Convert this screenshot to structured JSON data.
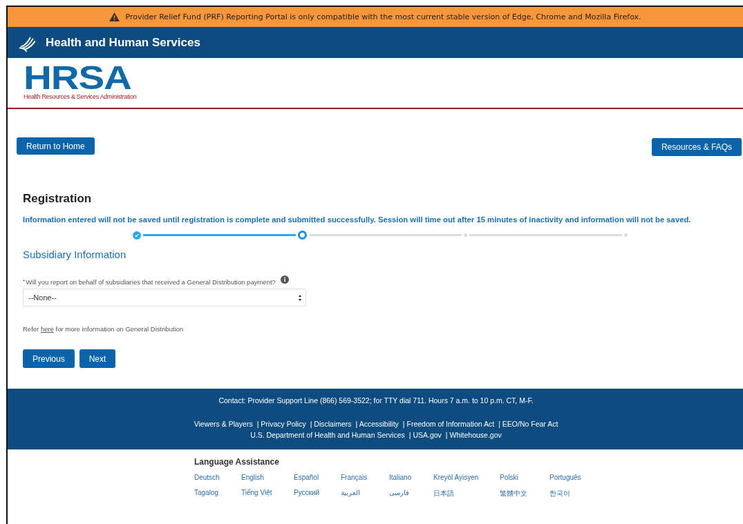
{
  "alert_bar": {
    "text": "Provider Relief Fund (PRF) Reporting Portal is only compatible with the most current stable version of Edge, Chrome and Mozilla Firefox."
  },
  "header": {
    "title": "Health and Human Services"
  },
  "logo": {
    "wordmark": "HRSA",
    "subtitle": "Health Resources & Services Administration"
  },
  "nav_buttons": [
    "Return to Home",
    "Resources & FAQs"
  ],
  "page_title": "Registration",
  "notice": "Information entered will not be saved until registration is complete and submitted successfully. Session will time out after 15 minutes of inactivity and information will not be saved.",
  "stepper": [
    {
      "kind": "complete"
    },
    {
      "kind": "current"
    },
    {
      "kind": "upcoming"
    },
    {
      "kind": "upcoming"
    }
  ],
  "section_title": "Subsidiary Information",
  "question": {
    "required_mark": "*",
    "label": "Will you report on behalf of subsidiaries that received a General Distribution payment?",
    "value": "--None--"
  },
  "refer": {
    "before": "Refer ",
    "link": "here",
    "after": " for more information on General Distribution"
  },
  "form_buttons": [
    "Previous",
    "Next"
  ],
  "footer": {
    "contact": "Contact: Provider Support Line (866) 569-3522; for TTY dial 711. Hours 7 a.m. to 10 p.m. CT, M-F.",
    "link_rows": [
      [
        "Viewers & Players",
        "| Privacy Policy",
        "| Disclaimers",
        "| Accessibility",
        "| Freedom of Information Act",
        "| EEO/No Fear Act"
      ],
      [
        "U.S. Department of Health and Human Services",
        "| USA.gov",
        "| Whitehouse.gov"
      ]
    ]
  },
  "language_assistance": {
    "title": "Language Assistance",
    "languages": [
      "Deutsch",
      "English",
      "Español",
      "Français",
      "Italiano",
      "Kreyòl Ayisyen",
      "Polski",
      "Português",
      "Tagalog",
      "Tiếng Việt",
      "Русский",
      "العربية",
      "فارسی",
      "日本語",
      "繁體中文",
      "한국어"
    ]
  }
}
